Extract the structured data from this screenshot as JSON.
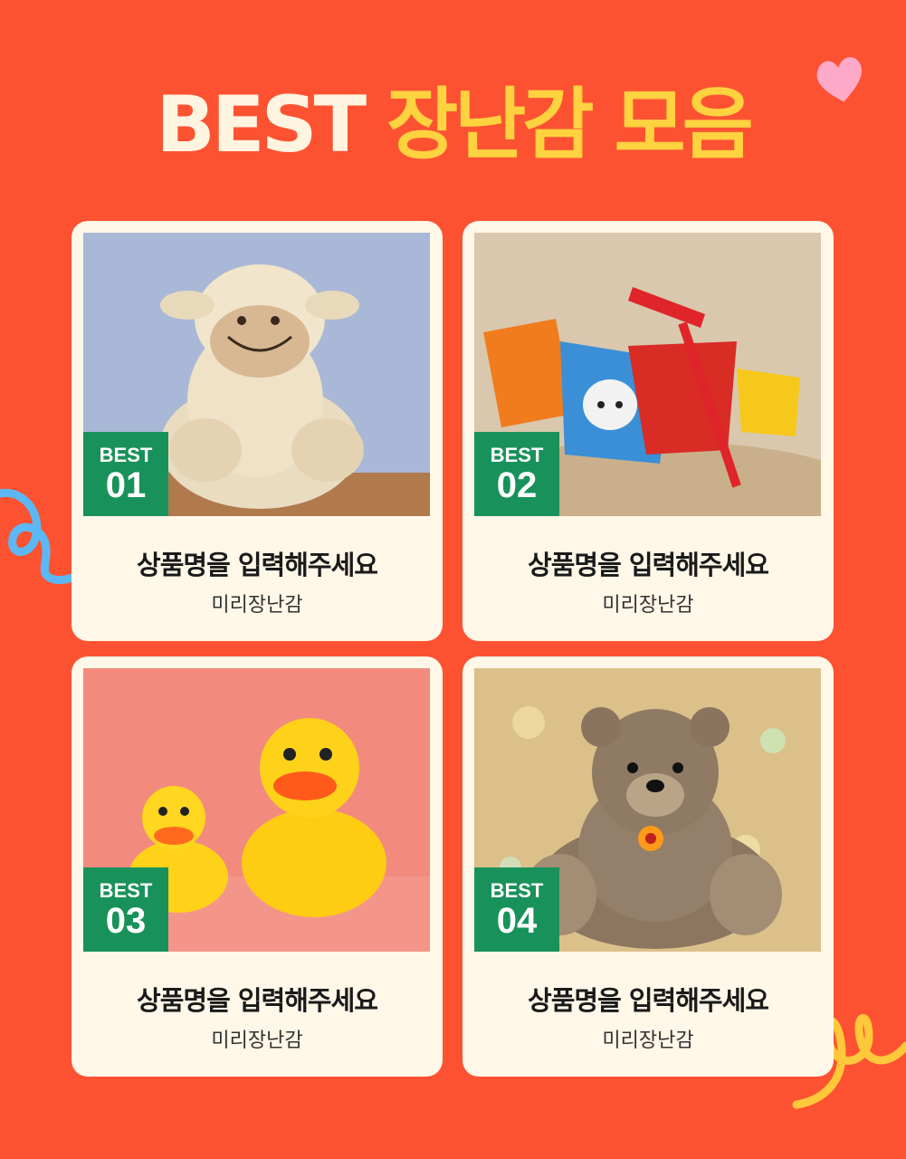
{
  "header": {
    "title_white": "BEST",
    "title_yellow": "장난감 모음"
  },
  "products": [
    {
      "badge_label": "BEST",
      "rank": "01",
      "name": "상품명을 입력해주세요",
      "brand": "미리장난감",
      "image": "plush-lamb"
    },
    {
      "badge_label": "BEST",
      "rank": "02",
      "name": "상품명을 입력해주세요",
      "brand": "미리장난감",
      "image": "beach-sand-toys"
    },
    {
      "badge_label": "BEST",
      "rank": "03",
      "name": "상품명을 입력해주세요",
      "brand": "미리장난감",
      "image": "rubber-ducks"
    },
    {
      "badge_label": "BEST",
      "rank": "04",
      "name": "상품명을 입력해주세요",
      "brand": "미리장난감",
      "image": "teddy-bear"
    }
  ],
  "colors": {
    "background": "#fd5232",
    "card": "#fff7e8",
    "badge": "#18925a",
    "title_accent": "#ffd23f"
  }
}
